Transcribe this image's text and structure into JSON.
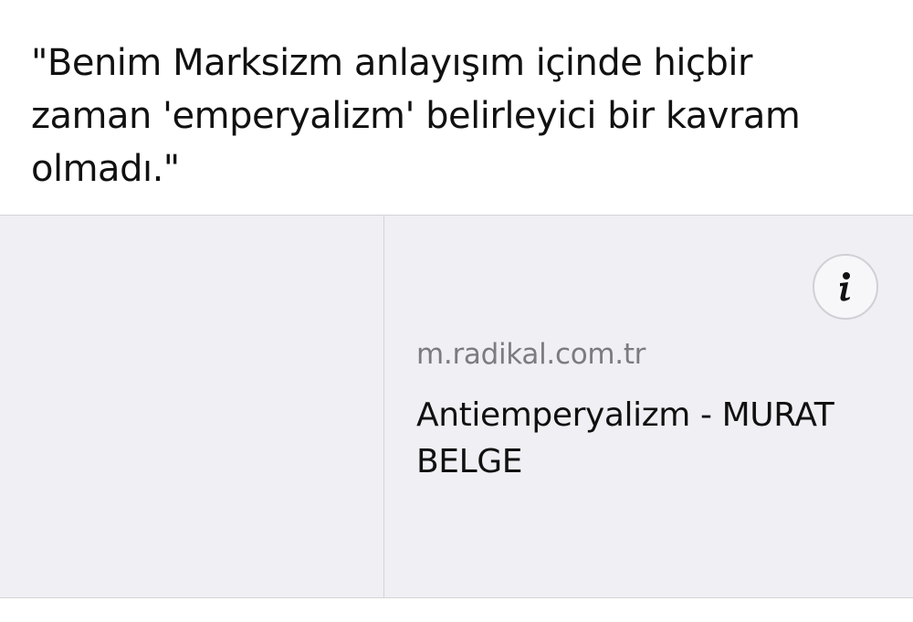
{
  "quote": {
    "text": "\"Benim Marksizm anlayışım içinde hiçbir zaman 'emperyalizm' belirleyici bir kavram olmadı.\""
  },
  "link_preview": {
    "domain": "m.radikal.com.tr",
    "title": "Antiemperyalizm - MURAT BELGE",
    "info_icon": "info-icon"
  },
  "colors": {
    "card_background": "#f0f0f4",
    "domain_text": "#7b7b80",
    "primary_text": "#111111",
    "divider": "#d3d3d8"
  }
}
